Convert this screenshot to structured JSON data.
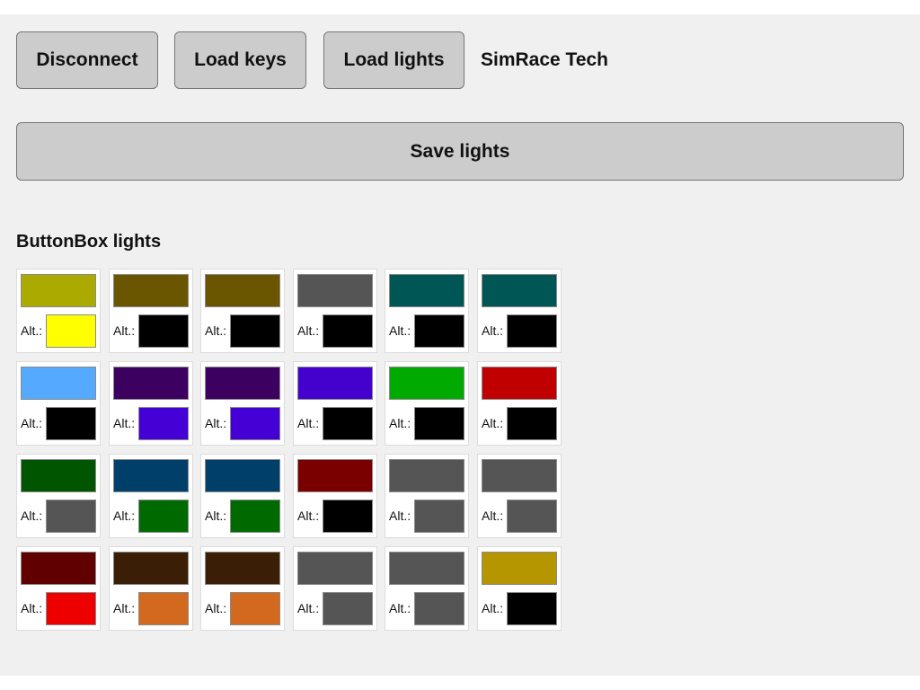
{
  "toolbar": {
    "disconnect_label": "Disconnect",
    "load_keys_label": "Load keys",
    "load_lights_label": "Load lights",
    "brand": "SimRace Tech"
  },
  "save_label": "Save lights",
  "section_title": "ButtonBox lights",
  "alt_label": "Alt.:",
  "lights": [
    {
      "color": "#aaaa00",
      "alt": "#ffff00"
    },
    {
      "color": "#6a5500",
      "alt": "#000000"
    },
    {
      "color": "#6a5500",
      "alt": "#000000"
    },
    {
      "color": "#555555",
      "alt": "#000000"
    },
    {
      "color": "#005555",
      "alt": "#000000"
    },
    {
      "color": "#005555",
      "alt": "#000000"
    },
    {
      "color": "#55aaff",
      "alt": "#000000"
    },
    {
      "color": "#3b0060",
      "alt": "#4400d5"
    },
    {
      "color": "#3b0060",
      "alt": "#4400d5"
    },
    {
      "color": "#4400cc",
      "alt": "#000000"
    },
    {
      "color": "#00aa00",
      "alt": "#000000"
    },
    {
      "color": "#c00000",
      "alt": "#000000"
    },
    {
      "color": "#005500",
      "alt": "#555555"
    },
    {
      "color": "#003f6a",
      "alt": "#006a00"
    },
    {
      "color": "#003f6a",
      "alt": "#006a00"
    },
    {
      "color": "#7a0000",
      "alt": "#000000"
    },
    {
      "color": "#555555",
      "alt": "#555555"
    },
    {
      "color": "#555555",
      "alt": "#555555"
    },
    {
      "color": "#600000",
      "alt": "#ee0000"
    },
    {
      "color": "#3a1e06",
      "alt": "#d2691e"
    },
    {
      "color": "#3a1e06",
      "alt": "#d2691e"
    },
    {
      "color": "#555555",
      "alt": "#555555"
    },
    {
      "color": "#555555",
      "alt": "#555555"
    },
    {
      "color": "#b59600",
      "alt": "#000000"
    }
  ]
}
